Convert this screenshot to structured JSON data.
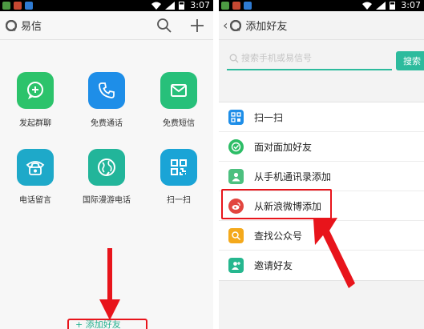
{
  "left": {
    "status": {
      "time": "3:07"
    },
    "header": {
      "title": "易信"
    },
    "grid": [
      {
        "label": "发起群聊",
        "color": "#2cc36b",
        "icon": "group-chat-icon"
      },
      {
        "label": "免费通话",
        "color": "#1e8ee8",
        "icon": "phone-icon"
      },
      {
        "label": "免费短信",
        "color": "#27c07a",
        "icon": "envelope-icon"
      },
      {
        "label": "电话留言",
        "color": "#1ea9c9",
        "icon": "telephone-icon"
      },
      {
        "label": "国际漫游电话",
        "color": "#22b59a",
        "icon": "globe-phone-icon"
      },
      {
        "label": "扫一扫",
        "color": "#1aa4d6",
        "icon": "qr-code-icon"
      }
    ],
    "bottom_label": "+ 添加好友"
  },
  "right": {
    "status": {
      "time": "3:07"
    },
    "header": {
      "back": "‹",
      "title": "添加好友"
    },
    "search": {
      "placeholder": "搜索手机或易信号",
      "button": "搜索"
    },
    "menu": [
      {
        "label": "扫一扫",
        "color": "#1e8ee8",
        "icon": "qr-code-icon"
      },
      {
        "label": "面对面加好友",
        "color": "#2cbd66",
        "icon": "face-to-face-icon"
      },
      {
        "label": "从手机通讯录添加",
        "color": "#4cc07f",
        "icon": "contact-icon"
      },
      {
        "label": "从新浪微博添加",
        "color": "#e2453f",
        "icon": "weibo-icon"
      },
      {
        "label": "查找公众号",
        "color": "#f4a91c",
        "icon": "search-public-icon"
      },
      {
        "label": "邀请好友",
        "color": "#26b78f",
        "icon": "invite-icon"
      }
    ]
  },
  "colors": {
    "accent": "#2dbb9d",
    "annotation": "#e8141b"
  }
}
